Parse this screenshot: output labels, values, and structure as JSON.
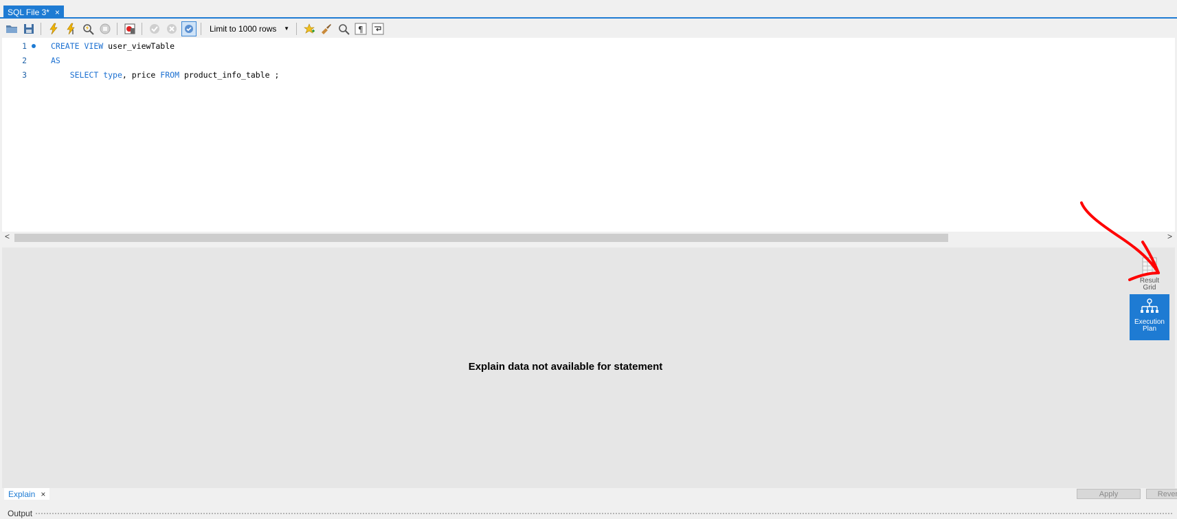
{
  "tab": {
    "label": "SQL File 3*",
    "close": "×"
  },
  "toolbar": {
    "limit_label": "Limit to 1000 rows"
  },
  "editor": {
    "lines": [
      {
        "num": "1"
      },
      {
        "num": "2"
      },
      {
        "num": "3"
      }
    ],
    "line1": {
      "kw1": "CREATE",
      "kw2": "VIEW",
      "id1": "user_viewTable"
    },
    "line2": {
      "kw1": "AS"
    },
    "line3": {
      "kw1": "SELECT",
      "kw2": "type",
      "id1": ", price",
      "kw3": "FROM",
      "id2": "product_info_table ;"
    }
  },
  "result": {
    "message": "Explain data not available for statement",
    "side": {
      "result_grid": {
        "line1": "Result",
        "line2": "Grid"
      },
      "exec_plan": {
        "line1": "Execution",
        "line2": "Plan"
      }
    }
  },
  "bottom": {
    "tab_label": "Explain",
    "tab_close": "×",
    "apply_label": "Apply",
    "revert_label": "Revert",
    "output_label": "Output"
  },
  "colors": {
    "accent": "#1e7bd3",
    "annotation": "#ff0000"
  }
}
